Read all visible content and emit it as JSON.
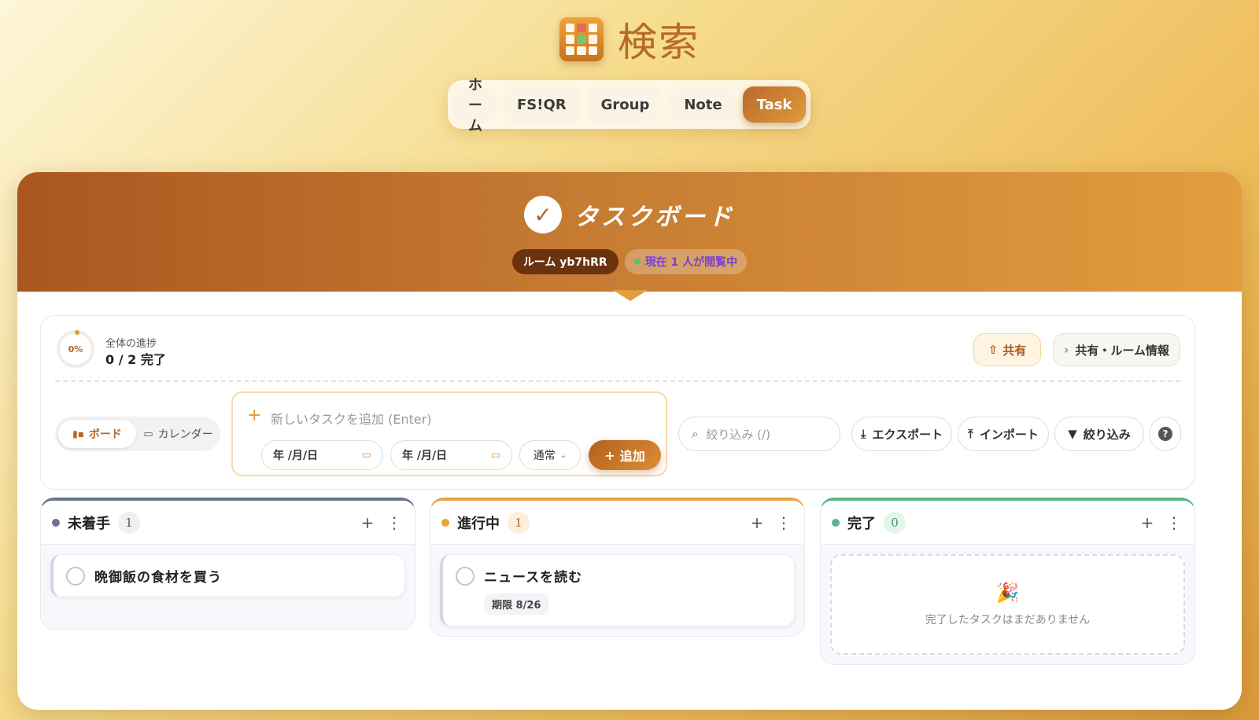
{
  "app": {
    "title": "検索",
    "nav": [
      {
        "label": "ホーム",
        "active": false
      },
      {
        "label": "FS!QR",
        "active": false
      },
      {
        "label": "Group",
        "active": false
      },
      {
        "label": "Note",
        "active": false
      },
      {
        "label": "Task",
        "active": true
      }
    ]
  },
  "banner": {
    "title": "タスクボード",
    "room_label": "ルーム yb7hRR",
    "viewers": "現在 1 人が閲覧中"
  },
  "progress": {
    "percent_text": "0%",
    "percent": 0,
    "label": "全体の進捗",
    "count": "0 / 2 完了"
  },
  "actions": {
    "share": "共有",
    "room_info": "共有・ルーム情報"
  },
  "view_toggle": {
    "board": "ボード",
    "calendar": "カレンダー"
  },
  "add_task": {
    "placeholder": "新しいタスクを追加 (Enter)",
    "date1": "年 /月/日",
    "date2": "年 /月/日",
    "priority": "通常",
    "submit": "追加"
  },
  "toolbar": {
    "filter_placeholder": "絞り込み (/)",
    "export": "エクスポート",
    "import": "インポート",
    "filter": "絞り込み",
    "help": "?"
  },
  "columns": [
    {
      "title": "未着手",
      "count": "1",
      "color": "#6b7390",
      "tasks": [
        {
          "title": "晩御飯の食材を買う"
        }
      ]
    },
    {
      "title": "進行中",
      "count": "1",
      "color": "#e7a341",
      "tasks": [
        {
          "title": "ニュースを読む",
          "due": "期限 8/26"
        }
      ]
    },
    {
      "title": "完了",
      "count": "0",
      "color": "#5bb58a",
      "empty_text": "完了したタスクはまだありません"
    }
  ],
  "colors": {
    "accent": "#b8662a",
    "accent_light": "#e39c3e"
  }
}
